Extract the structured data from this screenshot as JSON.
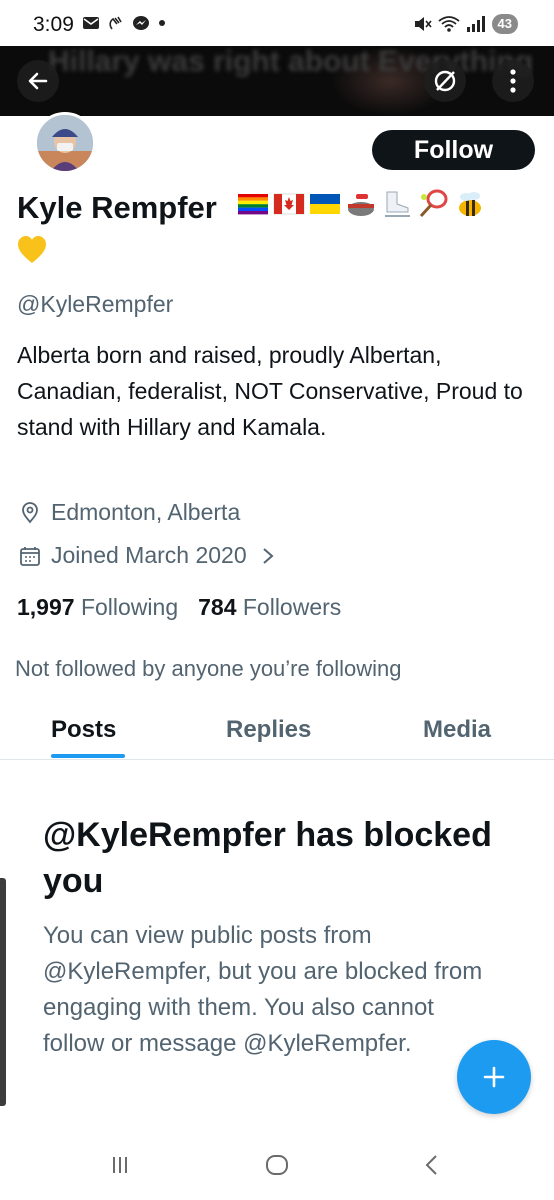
{
  "status_bar": {
    "time": "3:09",
    "battery": "43"
  },
  "banner": {
    "blurred_text": "Hillary was right about Everything"
  },
  "profile": {
    "follow_label": "Follow",
    "display_name": "Kyle Rempfer",
    "name_emojis": [
      "rainbow-flag",
      "canada-flag",
      "ukraine-flag",
      "curling-stone",
      "ice-skate",
      "tennis-racket",
      "honeybee",
      "yellow-heart"
    ],
    "handle": "@KyleRempfer",
    "bio": "Alberta born and raised, proudly Albertan, Canadian, federalist, NOT Conservative, Proud to stand with Hillary and Kamala.",
    "location": "Edmonton, Alberta",
    "joined": "Joined March 2020",
    "following_count": "1,997",
    "following_label": "Following",
    "followers_count": "784",
    "followers_label": "Followers",
    "not_followed_text": "Not followed by anyone you’re following"
  },
  "tabs": [
    {
      "label": "Posts",
      "selected": true
    },
    {
      "label": "Replies",
      "selected": false
    },
    {
      "label": "Media",
      "selected": false
    }
  ],
  "blocked_notice": {
    "title": "@KyleRempfer has blocked you",
    "body": "You can view public posts from @KyleRempfer, but you are blocked from engaging with them. You also cannot follow or message @KyleRempfer."
  },
  "colors": {
    "accent": "#1d9bf0",
    "text": "#0f1419",
    "secondary": "#536471"
  }
}
